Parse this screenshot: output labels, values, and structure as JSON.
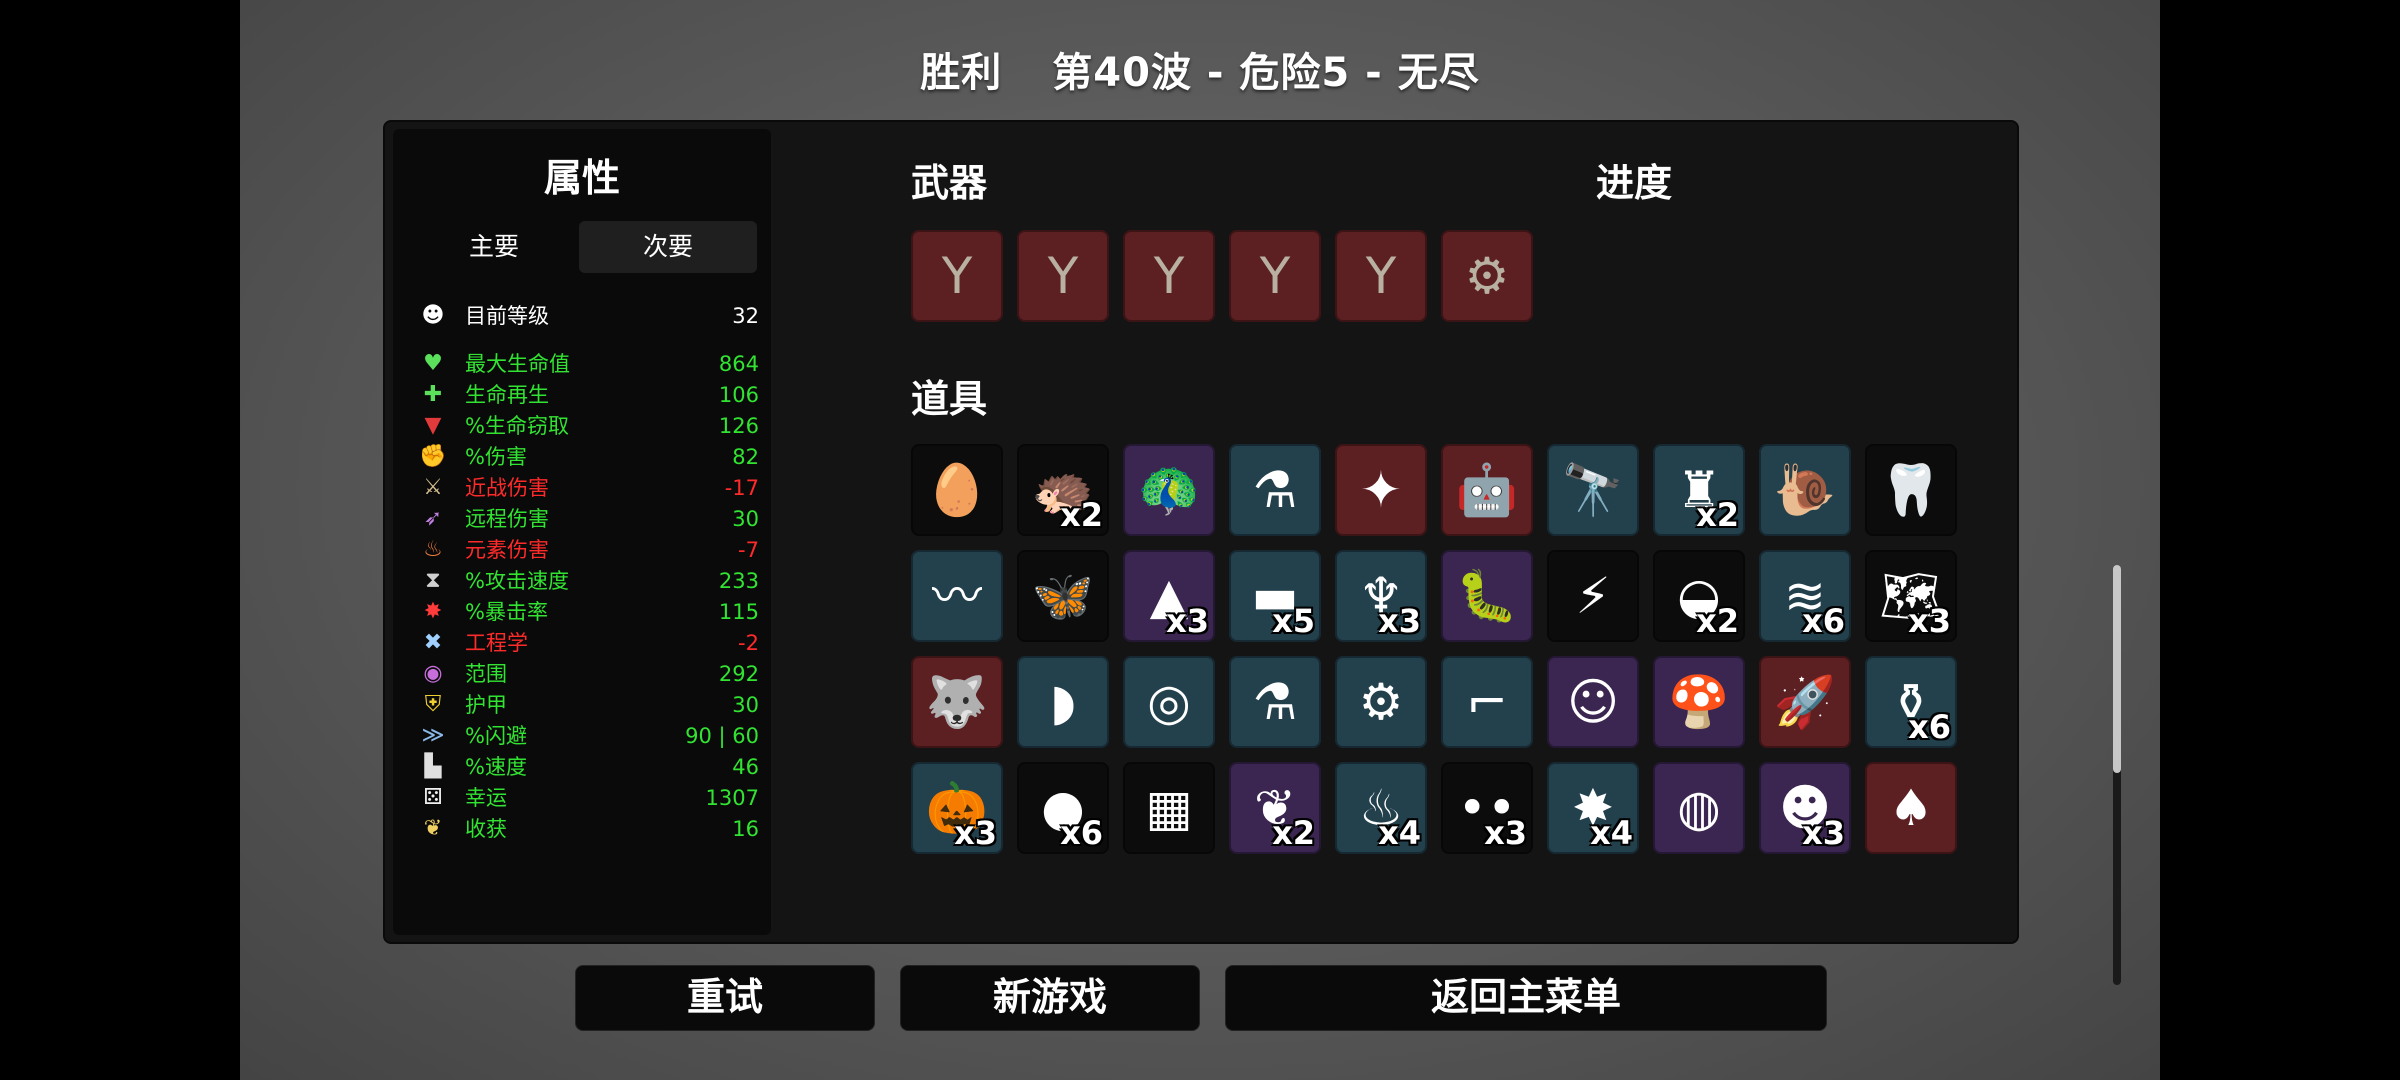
{
  "header": {
    "result": "胜利",
    "wave_info": "第40波 - 危险5 - 无尽"
  },
  "stats_panel": {
    "title": "属性",
    "tabs": [
      {
        "label": "主要",
        "active": false
      },
      {
        "label": "次要",
        "active": true
      }
    ],
    "level": {
      "label": "目前等级",
      "value": "32",
      "icon": "head-icon"
    },
    "stats": [
      {
        "label": "最大生命值",
        "value": "864",
        "color": "green",
        "icon": "heart-icon"
      },
      {
        "label": "生命再生",
        "value": "106",
        "color": "green",
        "icon": "regen-icon"
      },
      {
        "label": "%生命窃取",
        "value": "126",
        "color": "green",
        "icon": "fangs-icon"
      },
      {
        "label": "%伤害",
        "value": "82",
        "color": "green",
        "icon": "muscle-icon"
      },
      {
        "label": "近战伤害",
        "value": "-17",
        "color": "red",
        "icon": "sword-icon"
      },
      {
        "label": "远程伤害",
        "value": "30",
        "color": "green",
        "icon": "bow-icon"
      },
      {
        "label": "元素伤害",
        "value": "-7",
        "color": "red",
        "icon": "flame-icon"
      },
      {
        "label": "%攻击速度",
        "value": "233",
        "color": "green",
        "icon": "hourglass-icon"
      },
      {
        "label": "%暴击率",
        "value": "115",
        "color": "green",
        "icon": "crit-icon"
      },
      {
        "label": "工程学",
        "value": "-2",
        "color": "red",
        "icon": "wrench-icon"
      },
      {
        "label": "范围",
        "value": "292",
        "color": "green",
        "icon": "range-icon"
      },
      {
        "label": "护甲",
        "value": "30",
        "color": "green",
        "icon": "shield-icon"
      },
      {
        "label": "%闪避",
        "value": "90 | 60",
        "color": "green",
        "icon": "dodge-icon"
      },
      {
        "label": "%速度",
        "value": "46",
        "color": "green",
        "icon": "boot-icon"
      },
      {
        "label": "幸运",
        "value": "1307",
        "color": "green",
        "icon": "dice-icon"
      },
      {
        "label": "收获",
        "value": "16",
        "color": "green",
        "icon": "wheat-icon"
      }
    ]
  },
  "weapons": {
    "title": "武器",
    "items": [
      {
        "name": "slingshot-icon",
        "tier": "red",
        "glyph": "Y"
      },
      {
        "name": "slingshot-icon",
        "tier": "red",
        "glyph": "Y"
      },
      {
        "name": "slingshot-icon",
        "tier": "red",
        "glyph": "Y"
      },
      {
        "name": "slingshot-icon",
        "tier": "red",
        "glyph": "Y"
      },
      {
        "name": "slingshot-icon",
        "tier": "red",
        "glyph": "Y"
      },
      {
        "name": "minigun-icon",
        "tier": "red",
        "glyph": "⚙"
      }
    ]
  },
  "progress": {
    "title": "进度"
  },
  "items": {
    "title": "道具",
    "rows": [
      [
        {
          "name": "egg-icon",
          "tier": "black",
          "glyph": "🥚",
          "count": ""
        },
        {
          "name": "hedgehog-icon",
          "tier": "black",
          "glyph": "🦔",
          "count": "x2"
        },
        {
          "name": "peacock-icon",
          "tier": "purple",
          "glyph": "🦚",
          "count": ""
        },
        {
          "name": "potion-icon",
          "tier": "blue",
          "glyph": "⚗",
          "count": ""
        },
        {
          "name": "sparkler-icon",
          "tier": "red",
          "glyph": "✦",
          "count": ""
        },
        {
          "name": "robot-icon",
          "tier": "red",
          "glyph": "🤖",
          "count": ""
        },
        {
          "name": "scope-icon",
          "tier": "blue",
          "glyph": "🔭",
          "count": ""
        },
        {
          "name": "turret-icon",
          "tier": "blue",
          "glyph": "♜",
          "count": "x2"
        },
        {
          "name": "snail-icon",
          "tier": "blue",
          "glyph": "🐌",
          "count": ""
        },
        {
          "name": "tooth-icon",
          "tier": "black",
          "glyph": "🦷",
          "count": ""
        }
      ],
      [
        {
          "name": "tentacle-icon",
          "tier": "blue",
          "glyph": "〰",
          "count": ""
        },
        {
          "name": "butterfly-icon",
          "tier": "black",
          "glyph": "🦋",
          "count": ""
        },
        {
          "name": "triangle-icon",
          "tier": "purple",
          "glyph": "▲",
          "count": "x3"
        },
        {
          "name": "dumbbell-icon",
          "tier": "blue",
          "glyph": "▬",
          "count": "x5"
        },
        {
          "name": "cape-icon",
          "tier": "blue",
          "glyph": "♆",
          "count": "x3"
        },
        {
          "name": "tardigrade-icon",
          "tier": "purple",
          "glyph": "🐛",
          "count": ""
        },
        {
          "name": "scar-icon",
          "tier": "black",
          "glyph": "⚡",
          "count": ""
        },
        {
          "name": "beanie-icon",
          "tier": "black",
          "glyph": "◒",
          "count": "x2"
        },
        {
          "name": "scarf-icon",
          "tier": "blue",
          "glyph": "≋",
          "count": "x6"
        },
        {
          "name": "map-icon",
          "tier": "black",
          "glyph": "🗺",
          "count": "x3"
        }
      ],
      [
        {
          "name": "wolf-icon",
          "tier": "red",
          "glyph": "🐺",
          "count": ""
        },
        {
          "name": "claw-icon",
          "tier": "blue",
          "glyph": "◗",
          "count": ""
        },
        {
          "name": "amulet-icon",
          "tier": "blue",
          "glyph": "◎",
          "count": ""
        },
        {
          "name": "alchemy-icon",
          "tier": "blue",
          "glyph": "⚗",
          "count": ""
        },
        {
          "name": "machine-icon",
          "tier": "blue",
          "glyph": "⚙",
          "count": ""
        },
        {
          "name": "lamp-icon",
          "tier": "blue",
          "glyph": "⌐",
          "count": ""
        },
        {
          "name": "beard-icon",
          "tier": "purple",
          "glyph": "☺",
          "count": ""
        },
        {
          "name": "mushroom-icon",
          "tier": "purple",
          "glyph": "🍄",
          "count": ""
        },
        {
          "name": "rocket-icon",
          "tier": "red",
          "glyph": "🚀",
          "count": ""
        },
        {
          "name": "flask-icon",
          "tier": "blue",
          "glyph": "⚱",
          "count": "x6"
        }
      ],
      [
        {
          "name": "pumpkin-icon",
          "tier": "blue",
          "glyph": "🎃",
          "count": "x3"
        },
        {
          "name": "blob-icon",
          "tier": "black",
          "glyph": "●",
          "count": "x6"
        },
        {
          "name": "plaid-shirt-icon",
          "tier": "black",
          "glyph": "▦",
          "count": ""
        },
        {
          "name": "wings-icon",
          "tier": "purple",
          "glyph": "❦",
          "count": "x2"
        },
        {
          "name": "sauce-icon",
          "tier": "blue",
          "glyph": "♨",
          "count": "x4"
        },
        {
          "name": "eyes-icon",
          "tier": "black",
          "glyph": "••",
          "count": "x3"
        },
        {
          "name": "bomb-icon",
          "tier": "blue",
          "glyph": "✸",
          "count": "x4"
        },
        {
          "name": "ring-icon",
          "tier": "purple",
          "glyph": "◍",
          "count": ""
        },
        {
          "name": "zombie-icon",
          "tier": "purple",
          "glyph": "☻",
          "count": "x3"
        },
        {
          "name": "jacket-icon",
          "tier": "red",
          "glyph": "♠",
          "count": ""
        }
      ]
    ]
  },
  "buttons": {
    "retry": "重试",
    "new_game": "新游戏",
    "main_menu": "返回主菜单"
  },
  "colors": {
    "tier_red": "#5c1f22",
    "tier_blue": "#23404d",
    "tier_purple": "#3a2650",
    "tier_black": "#0c0c0c",
    "stat_green": "#32e432",
    "stat_red": "#ff2a2a"
  }
}
